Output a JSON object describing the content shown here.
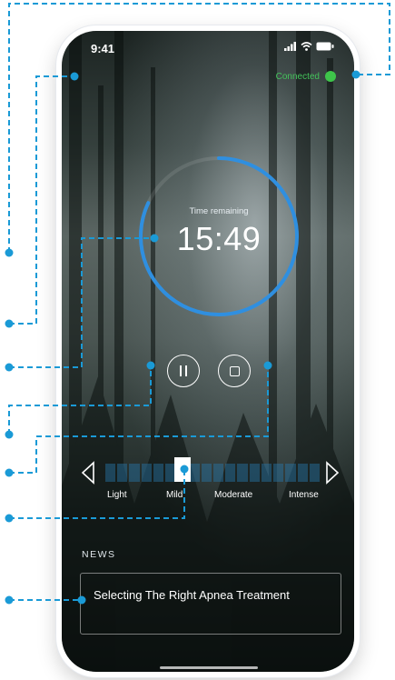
{
  "status_bar": {
    "time": "9:41"
  },
  "connection": {
    "label": "Connected",
    "color": "#43c35a"
  },
  "timer": {
    "label": "Time remaining",
    "value": "15:49",
    "ring_color": "#2f8fe0",
    "progress": 0.82
  },
  "controls": {
    "pause_icon": "pause-icon",
    "stop_icon": "stop-icon"
  },
  "intensity": {
    "levels": [
      "Light",
      "Mild",
      "Moderate",
      "Intense"
    ],
    "selected": "Mild",
    "segment_count": 18
  },
  "news": {
    "heading": "NEWS",
    "item_title": "Selecting The Right Apnea Treatment"
  },
  "annotation_color": "#1a9ad6"
}
